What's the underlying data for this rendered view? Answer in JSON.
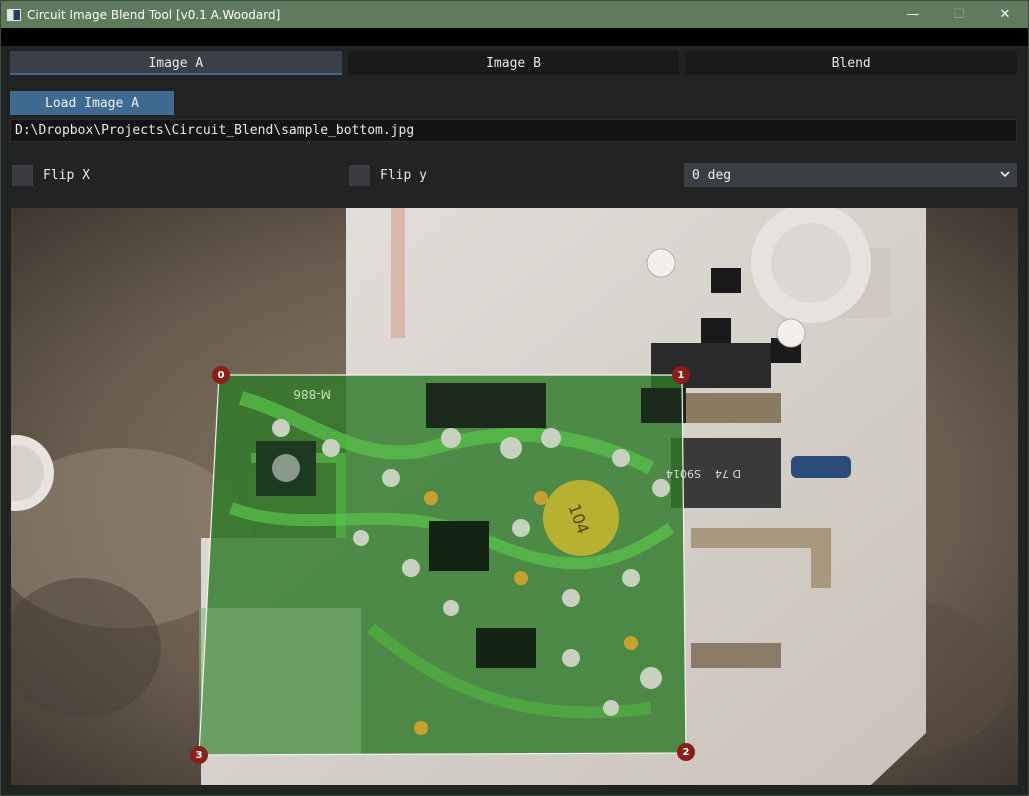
{
  "window": {
    "title": "Circuit Image Blend Tool [v0.1 A.Woodard]",
    "controls": {
      "minimize": "—",
      "maximize": "☐",
      "close": "✕"
    }
  },
  "tabs": [
    {
      "label": "Image A",
      "active": true
    },
    {
      "label": "Image B",
      "active": false
    },
    {
      "label": "Blend",
      "active": false
    }
  ],
  "image_a": {
    "load_button_label": "Load Image A",
    "file_path": "D:\\Dropbox\\Projects\\Circuit_Blend\\sample_bottom.jpg",
    "flip_x": {
      "label": "Flip X",
      "checked": false
    },
    "flip_y": {
      "label": "Flip y",
      "checked": false
    },
    "rotation": {
      "selected": "0 deg"
    }
  },
  "corners": [
    {
      "label": "0"
    },
    {
      "label": "1"
    },
    {
      "label": "2"
    },
    {
      "label": "3"
    }
  ],
  "pcb_labels": {
    "part_marking_1": "M-886",
    "capacitor_marking": "104",
    "chip_marking_1": "S9014",
    "chip_marking_2": "D 74"
  },
  "colors": {
    "titlebar": "#5f7a5c",
    "accent": "#3f6b93",
    "corner_handle": "#8a1f1c",
    "overlay_green": "#2f7a2a"
  }
}
